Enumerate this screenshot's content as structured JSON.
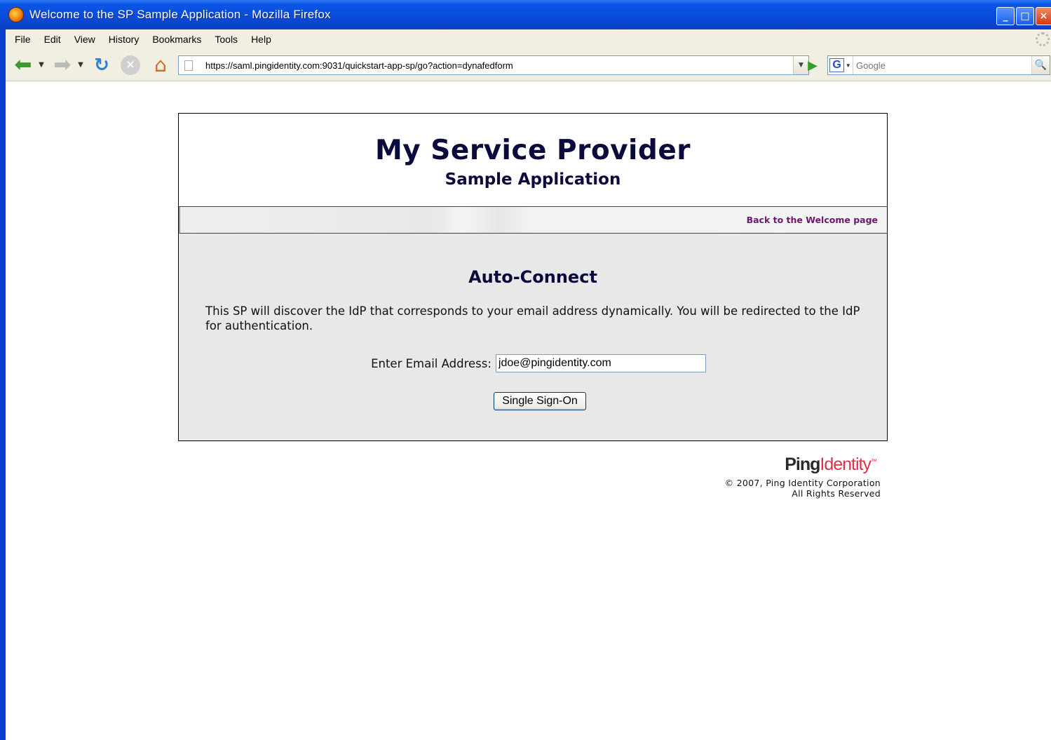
{
  "window": {
    "title": "Welcome to the SP Sample Application - Mozilla Firefox",
    "controls": {
      "minimize": "_",
      "maximize": "□",
      "close": "×"
    }
  },
  "menubar": {
    "items": [
      "File",
      "Edit",
      "View",
      "History",
      "Bookmarks",
      "Tools",
      "Help"
    ]
  },
  "navbar": {
    "icons": [
      "back-icon",
      "forward-icon",
      "reload-icon",
      "stop-icon",
      "home-icon",
      "go-icon"
    ],
    "url": "https://saml.pingidentity.com:9031/quickstart-app-sp/go?action=dynafedform",
    "search_placeholder": "Google",
    "search_engine": "G"
  },
  "page": {
    "title": "My Service Provider",
    "subtitle": "Sample Application",
    "back_link": "Back to the Welcome page",
    "heading": "Auto-Connect",
    "description": "This SP will discover the IdP that corresponds to your email address dynamically. You will be redirected to the IdP for authentication.",
    "email_label": "Enter Email Address:",
    "email_value": "jdoe@pingidentity.com",
    "sso_button": "Single Sign-On"
  },
  "footer": {
    "logo_ping": "Ping",
    "logo_identity": "Identity",
    "logo_tm": "™",
    "copyright": "© 2007, Ping Identity Corporation",
    "rights": "All Rights Reserved"
  },
  "colors": {
    "titlebar": "#0a4ad8",
    "chrome": "#f1efe2",
    "heading": "#0a0a3c",
    "link": "#6a1a6a",
    "panel": "#e8e8e8",
    "logo_accent": "#e0304a"
  }
}
